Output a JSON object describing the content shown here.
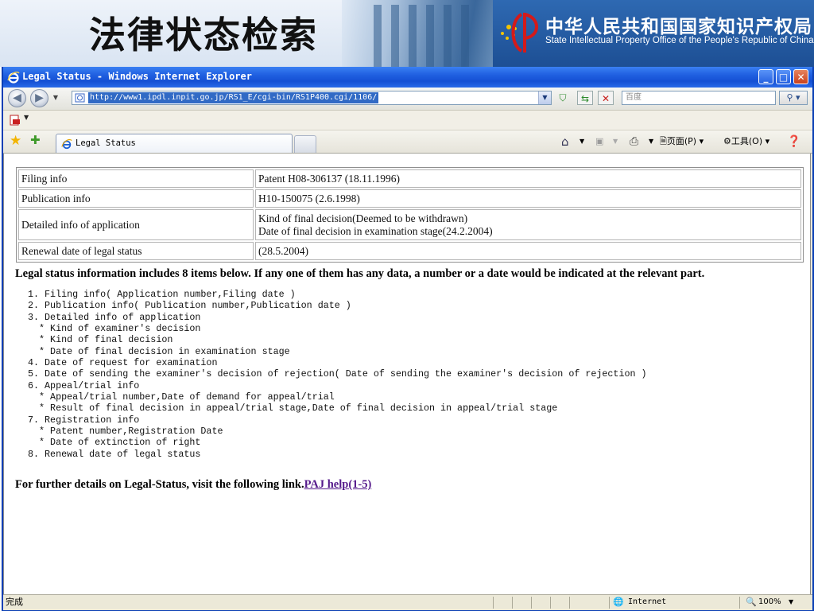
{
  "slide": {
    "title": "法律状态检索",
    "org_cn": "中华人民共和国国家知识产权局",
    "org_en": "State Intellectual Property Office of the People's Republic of China"
  },
  "window": {
    "title": "Legal Status - Windows Internet Explorer",
    "minimize_icon": "minimize-icon",
    "maximize_icon": "maximize-icon",
    "close_icon": "close-icon"
  },
  "navbar": {
    "address": "http://www1.ipdl.inpit.go.jp/RS1_E/cgi-bin/RS1P400.cgi/1106/",
    "search_placeholder": "百度"
  },
  "tabs": [
    {
      "label": "Legal Status"
    }
  ],
  "commandbar": {
    "page_label": "页面(P)",
    "tools_label": "工具(O)"
  },
  "legal_table": [
    {
      "key": "Filing info",
      "value": "Patent H08-306137 (18.11.1996)"
    },
    {
      "key": "Publication info",
      "value": "H10-150075 (2.6.1998)"
    },
    {
      "key": "Detailed info of application",
      "value_lines": [
        "Kind of final decision(Deemed to be withdrawn)",
        "Date of final decision in examination stage(24.2.2004)"
      ]
    },
    {
      "key": "Renewal date of legal status",
      "value": "(28.5.2004)"
    }
  ],
  "intro_text": "Legal status information includes 8 items below. If any one of them has any data, a number or a date would be indicated at the relevant part.",
  "items_list": [
    "1. Filing info( Application number,Filing date )",
    "2. Publication info( Publication number,Publication date )",
    "3. Detailed info of application",
    "  * Kind of examiner's decision",
    "  * Kind of final decision",
    "  * Date of final decision in examination stage",
    "4. Date of request for examination",
    "5. Date of sending the examiner's decision of rejection( Date of sending the examiner's decision of rejection )",
    "6. Appeal/trial info",
    "  * Appeal/trial number,Date of demand for appeal/trial",
    "  * Result of final decision in appeal/trial stage,Date of final decision in appeal/trial stage",
    "7. Registration info",
    "  * Patent number,Registration Date",
    "  * Date of extinction of right",
    "8. Renewal date of legal status"
  ],
  "further_text": "For further details on Legal-Status, visit the following link.",
  "further_link": "PAJ help(1-5)",
  "statusbar": {
    "status": "完成",
    "zone": "Internet",
    "zoom": "100%"
  }
}
